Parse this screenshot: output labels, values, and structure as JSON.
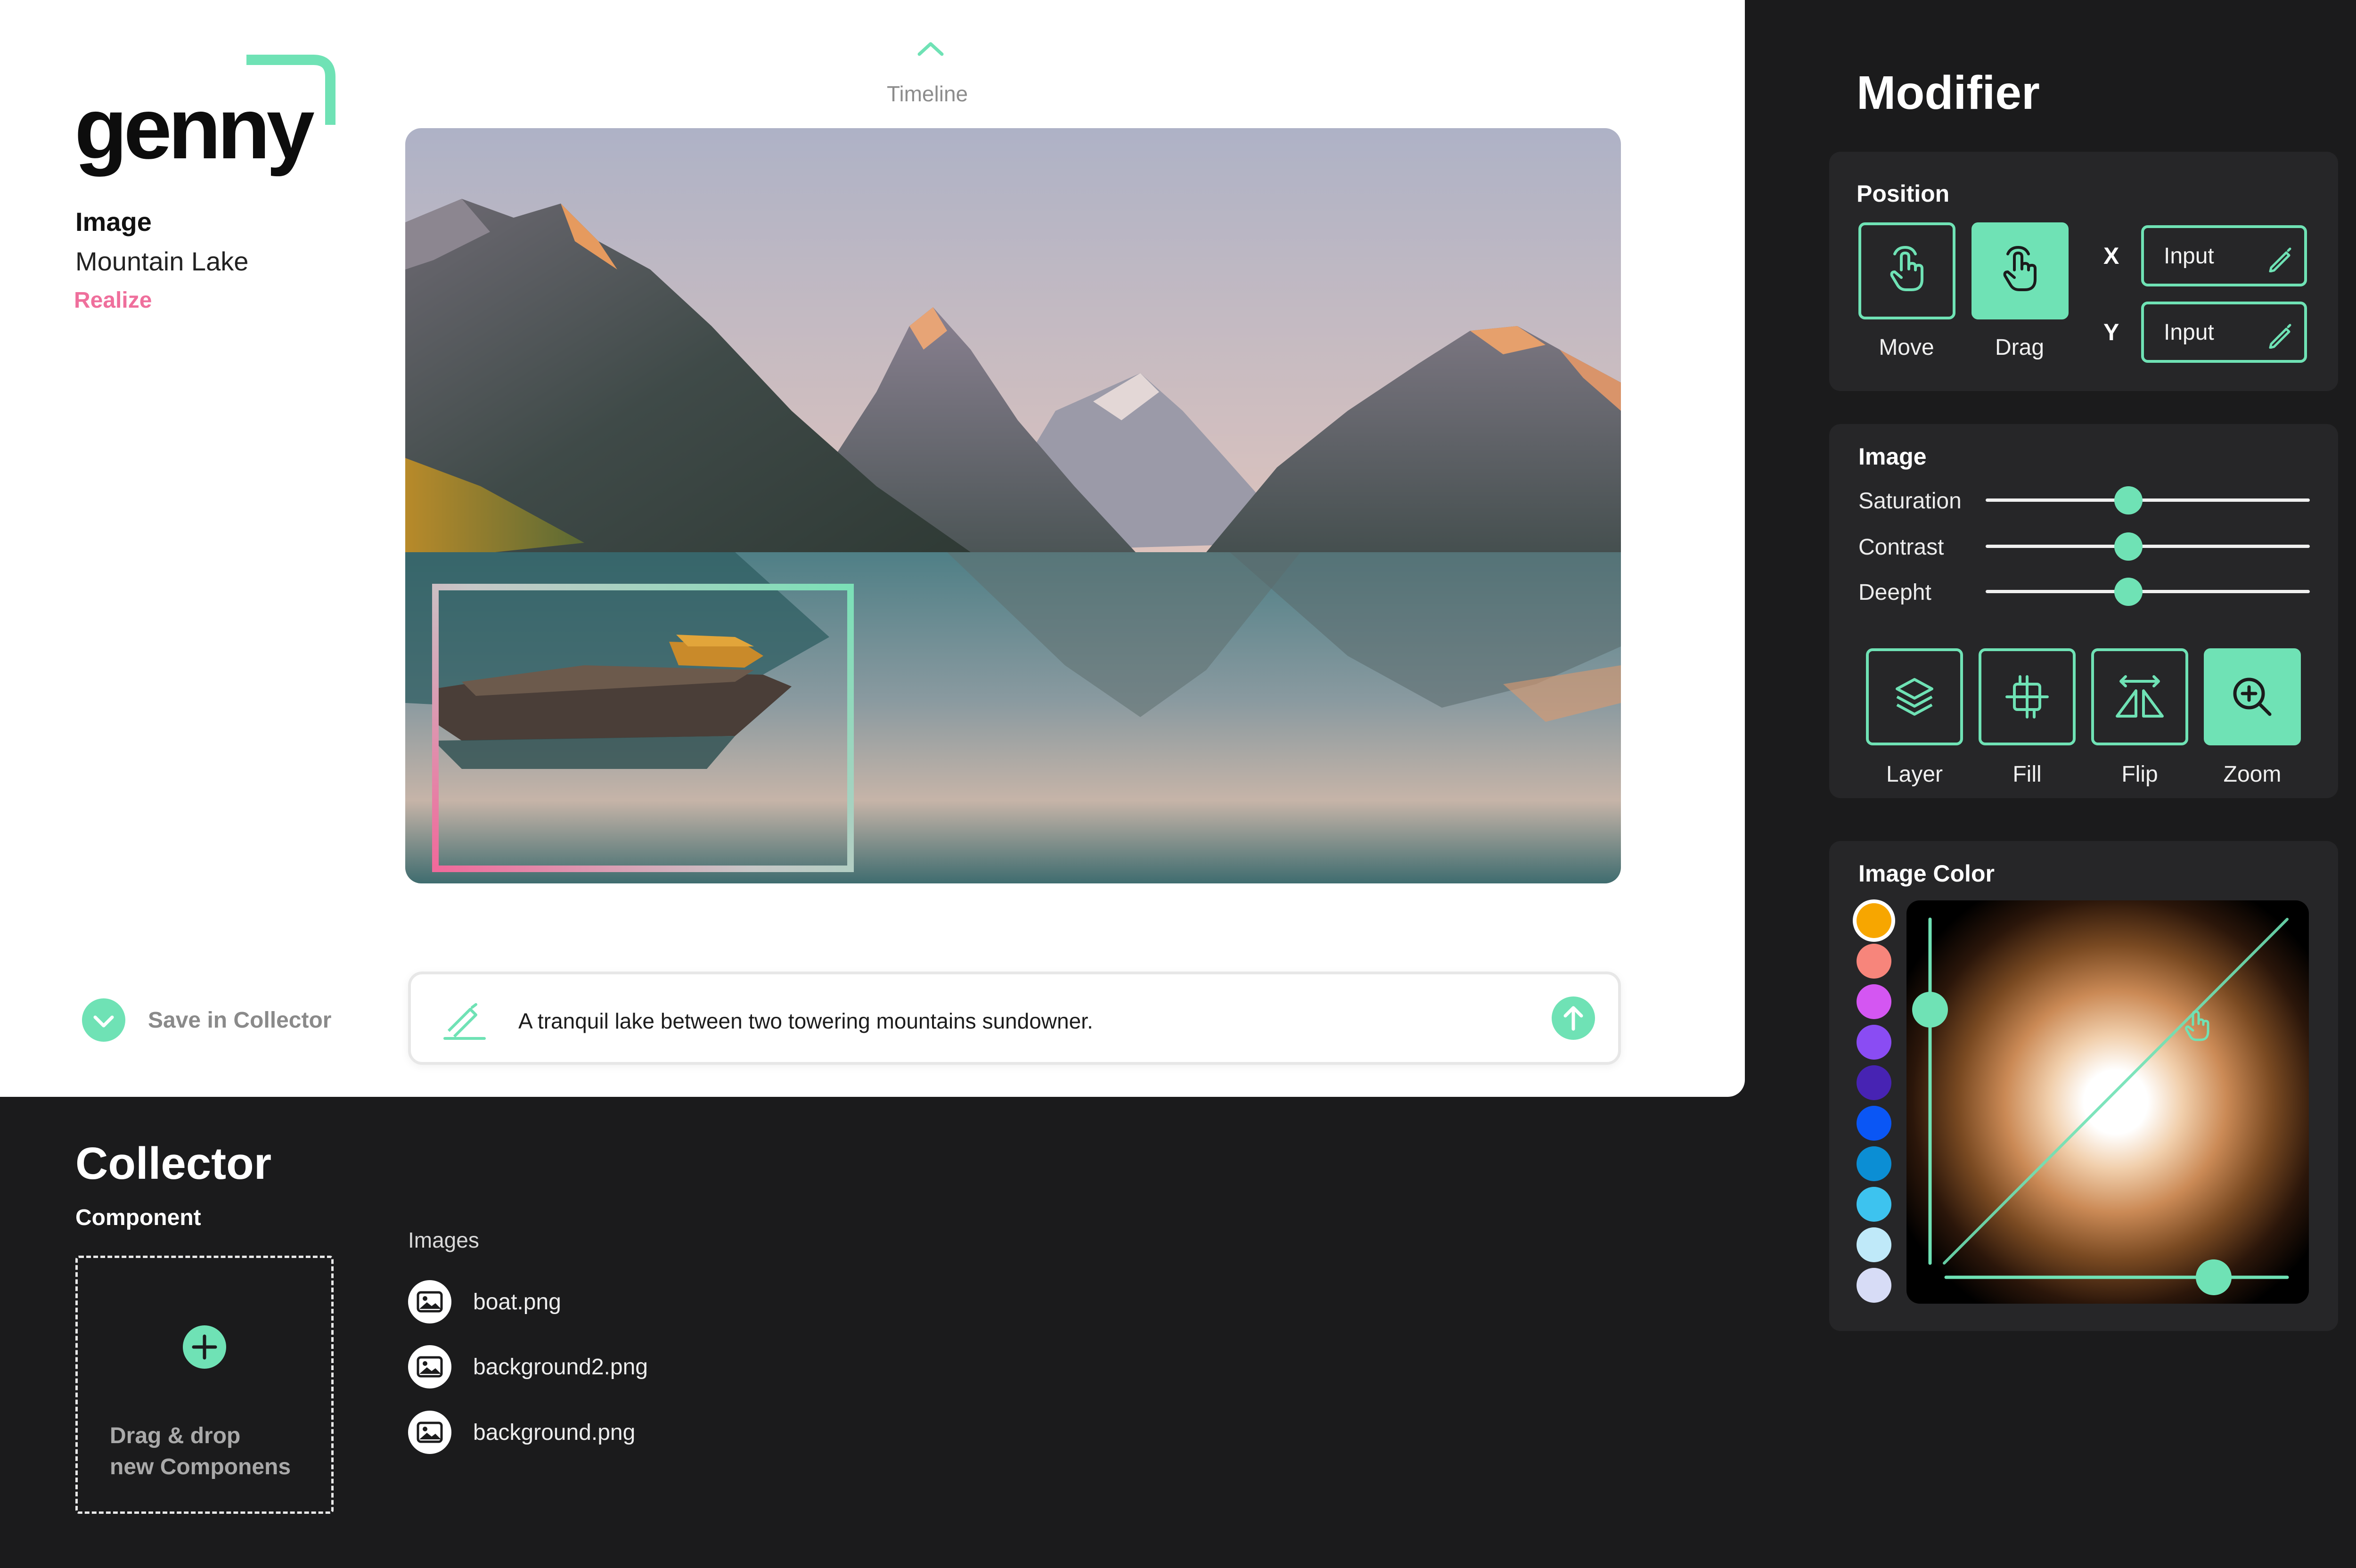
{
  "brand": {
    "name": "genny"
  },
  "project": {
    "type": "Image",
    "name": "Mountain Lake",
    "action": "Realize"
  },
  "timeline": {
    "label": "Timeline"
  },
  "save": {
    "label": "Save in Collector"
  },
  "prompt": {
    "text": "A tranquil lake between two towering mountains sundowner."
  },
  "collector": {
    "title": "Collector",
    "component_label": "Component",
    "dropzone_line1": "Drag & drop",
    "dropzone_line2": "new Componens",
    "images_label": "Images",
    "files": [
      "boat.png",
      "background2.png",
      "background.png"
    ]
  },
  "modifier": {
    "title": "Modifier",
    "position": {
      "title": "Position",
      "move_label": "Move",
      "drag_label": "Drag",
      "x_label": "X",
      "y_label": "Y",
      "x_placeholder": "Input",
      "y_placeholder": "Input"
    },
    "image": {
      "title": "Image",
      "sliders": [
        {
          "label": "Saturation",
          "value": 0.44
        },
        {
          "label": "Contrast",
          "value": 0.44
        },
        {
          "label": "Deepht",
          "value": 0.44
        }
      ],
      "tools": [
        {
          "label": "Layer",
          "icon": "layers-icon",
          "active": false
        },
        {
          "label": "Fill",
          "icon": "crop-icon",
          "active": false
        },
        {
          "label": "Flip",
          "icon": "flip-icon",
          "active": false
        },
        {
          "label": "Zoom",
          "icon": "zoom-icon",
          "active": true
        }
      ]
    },
    "image_color": {
      "title": "Image Color",
      "swatches": [
        "#f7a600",
        "#f7857b",
        "#d456f2",
        "#8a4cf3",
        "#4723b3",
        "#0a56f5",
        "#0b8ed4",
        "#3dc3ef",
        "#bfe9f9",
        "#d7dcf6"
      ],
      "selected_swatch": 0
    }
  },
  "colors": {
    "accent": "#6fe2b5",
    "pink": "#ef6f9c",
    "dark": "#1b1b1c",
    "card": "#262628"
  }
}
